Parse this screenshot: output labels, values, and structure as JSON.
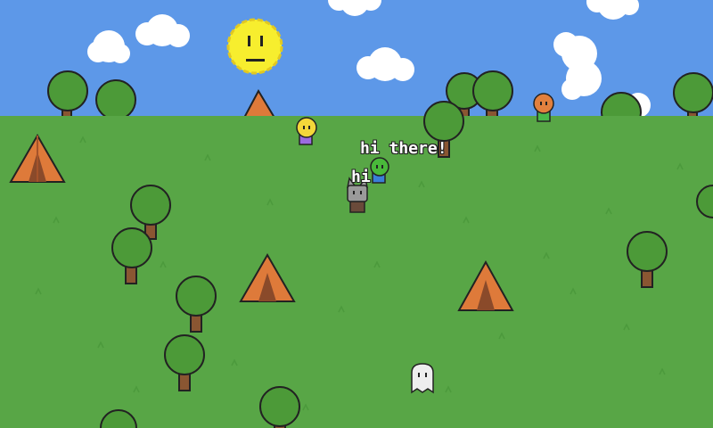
{
  "colors": {
    "sky": "#5d98e8",
    "grass": "#58a646",
    "grass_dark": "#4c9a3c",
    "tree_leaf": "#4c9a38",
    "tree_trunk": "#8a5632",
    "tent": "#de7a3a",
    "sun": "#f7ee2e",
    "outline": "#222222"
  },
  "chat": [
    {
      "text": "hi there!"
    },
    {
      "text": "hi"
    }
  ],
  "characters": [
    {
      "name": "yellow-blob-player",
      "color": "#f4d73a",
      "shirt": "#9b6be0"
    },
    {
      "name": "green-blob-player",
      "color": "#49b93a",
      "shirt": "#3a7fd8"
    },
    {
      "name": "gray-cat-player",
      "color": "#9a9a9a",
      "shirt": "#6a4a3a"
    },
    {
      "name": "orange-blob-player",
      "color": "#e2803e",
      "shirt": "#49b94a"
    },
    {
      "name": "white-ghost-player",
      "color": "#eeeeee",
      "shirt": "#eeeeee"
    }
  ]
}
